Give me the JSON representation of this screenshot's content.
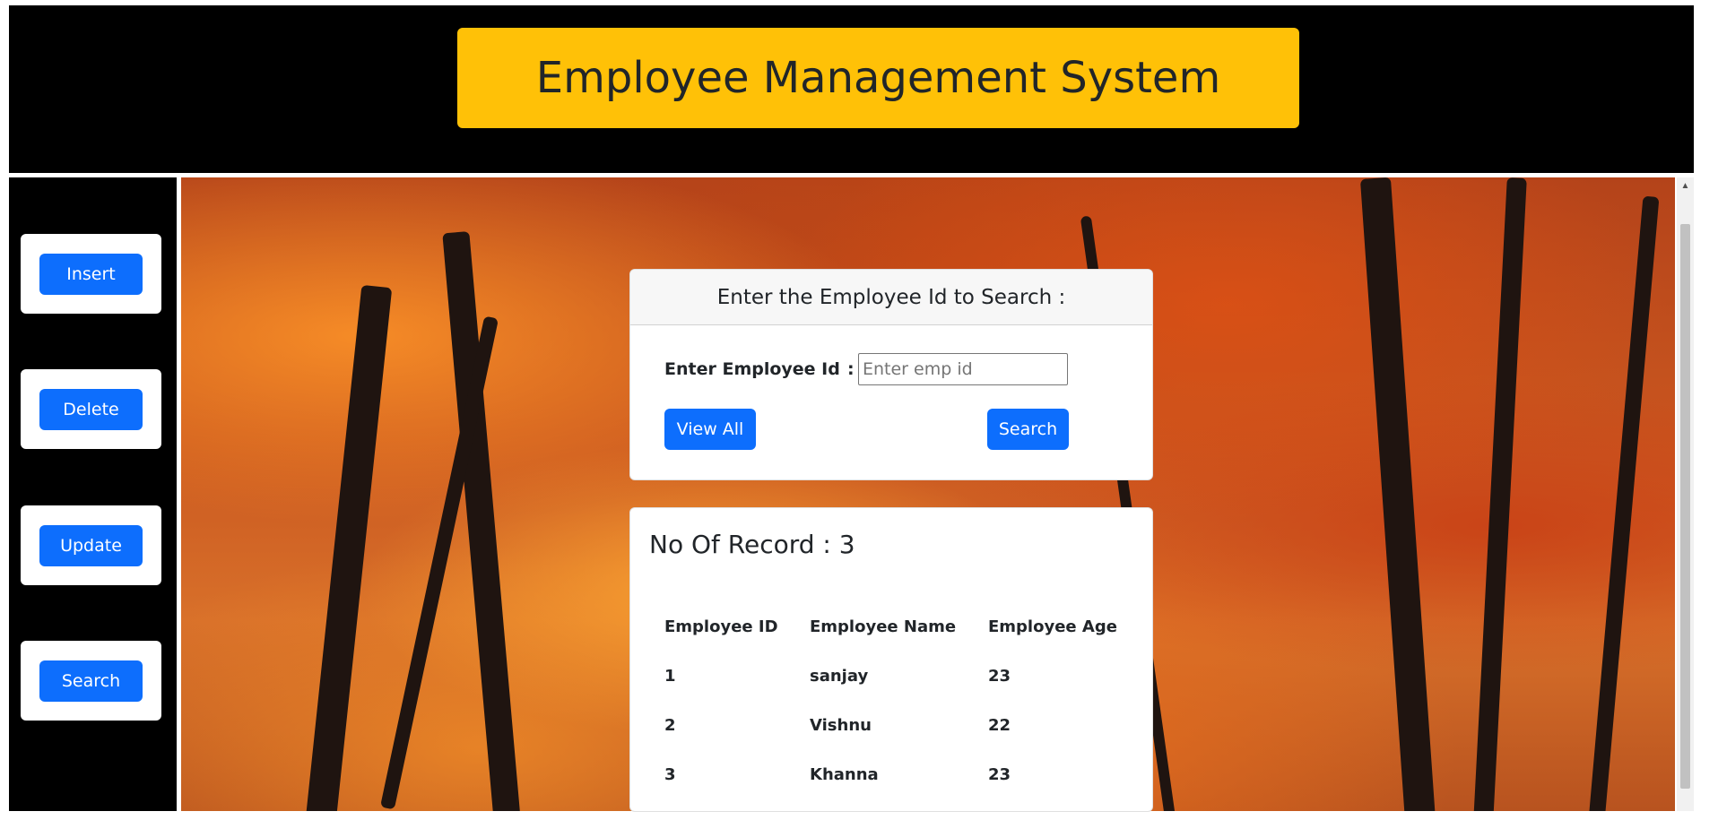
{
  "header": {
    "title": "Employee Management System",
    "title_bg": "#ffc107"
  },
  "sidebar": {
    "items": [
      {
        "label": "Insert"
      },
      {
        "label": "Delete"
      },
      {
        "label": "Update"
      },
      {
        "label": "Search"
      }
    ]
  },
  "search_card": {
    "heading": "Enter the Employee Id to Search :",
    "field_label": "Enter Employee Id",
    "colon": ":",
    "input_placeholder": "Enter emp id",
    "input_value": "",
    "view_all_label": "View All",
    "search_label": "Search"
  },
  "records": {
    "count_text": "No Of Record : 3",
    "columns": [
      "Employee ID",
      "Employee Name",
      "Employee Age"
    ],
    "rows": [
      {
        "id": "1",
        "name": "sanjay",
        "age": "23"
      },
      {
        "id": "2",
        "name": "Vishnu",
        "age": "22"
      },
      {
        "id": "3",
        "name": "Khanna",
        "age": "23"
      }
    ]
  },
  "colors": {
    "primary_button": "#0d6efd",
    "background_dark": "#000000"
  },
  "icons": {
    "scroll_up": "scroll-up-arrow-icon",
    "background": "autumn-forest-image"
  }
}
